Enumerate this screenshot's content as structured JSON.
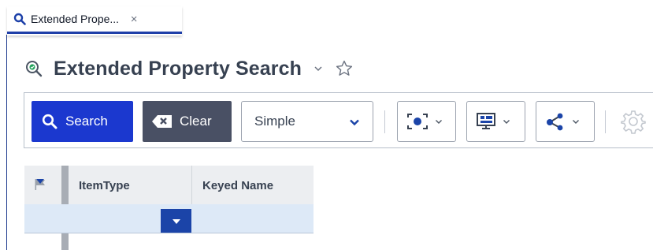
{
  "tab": {
    "title": "Extended Prope...",
    "close_glyph": "×",
    "icon": "search-icon"
  },
  "header": {
    "title": "Extended Property Search",
    "icon": "extended-search-icon",
    "chevron_icon": "chevron-down-icon",
    "favorite_icon": "star-outline-icon"
  },
  "toolbar": {
    "search_label": "Search",
    "clear_label": "Clear",
    "mode_value": "Simple",
    "dropdowns": [
      "capture-icon",
      "display-icon",
      "share-icon"
    ],
    "settings_icon": "gear-icon"
  },
  "grid": {
    "columns": [
      "ItemType",
      "Keyed Name"
    ],
    "flag_icon": "flag-icon"
  },
  "colors": {
    "primary": "#1b38cf",
    "clear": "#495064",
    "filter_row": "#dde9f7",
    "dropdown_button": "#1b44a8"
  }
}
